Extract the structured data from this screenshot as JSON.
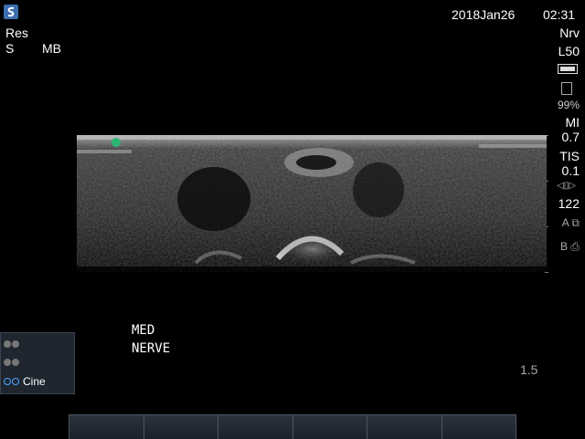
{
  "header": {
    "date": "2018Jan26",
    "time": "02:31",
    "preset": "Res",
    "mode_s": "S",
    "mode_mb": "MB"
  },
  "right_panel": {
    "exam": "Nrv",
    "transducer": "L50",
    "storage_pct": "99%",
    "mi_label": "MI",
    "mi_value": "0.7",
    "tis_label": "TIS",
    "tis_value": "0.1",
    "frame_value": "122",
    "key_a": "A",
    "key_b": "B"
  },
  "annotations": {
    "line1": "MED",
    "line2": "NERVE"
  },
  "depth": "1.5",
  "cine_panel": {
    "items": [
      {
        "label": ""
      },
      {
        "label": ""
      },
      {
        "label": "Cine"
      }
    ]
  },
  "softkeys": [
    "",
    "",
    "",
    "",
    "",
    ""
  ],
  "icons": {
    "logo": "sonosite-logo-icon",
    "battery": "battery-icon",
    "storage": "disk-icon",
    "frame": "cine-frame-icon",
    "printer": "printer-icon",
    "orientation": "orientation-marker-icon"
  },
  "colors": {
    "orientation_marker": "#2bb673",
    "logo_blue": "#3d6fb0",
    "cine_panel_bg": "#1f2630"
  }
}
